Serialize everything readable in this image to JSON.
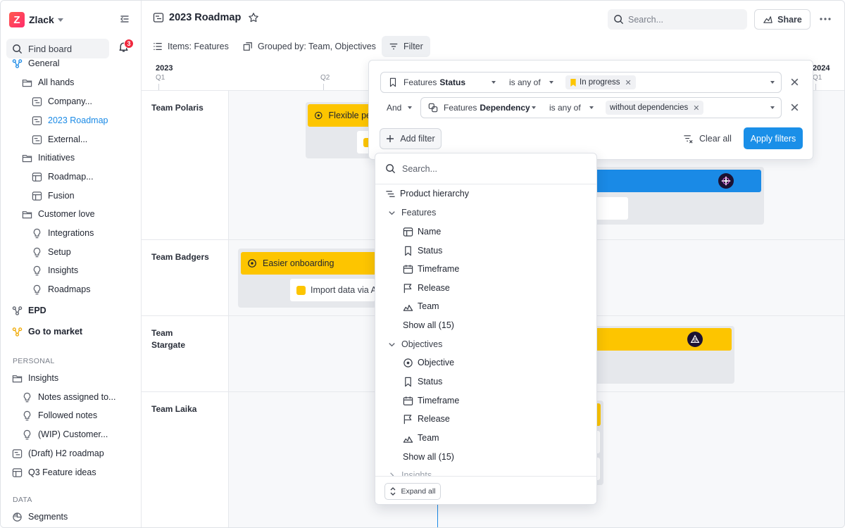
{
  "workspace": {
    "name": "Zlack",
    "logo_letter": "Z"
  },
  "sidebar": {
    "find_board": "Find board",
    "notification_count": "3",
    "items": [
      {
        "label": "General",
        "icon": "branch-icon"
      },
      {
        "label": "All hands",
        "icon": "folder-icon"
      },
      {
        "label": "Company...",
        "icon": "timeline-icon"
      },
      {
        "label": "2023 Roadmap",
        "icon": "timeline-icon",
        "active": true
      },
      {
        "label": "External...",
        "icon": "timeline-icon"
      },
      {
        "label": "Initiatives",
        "icon": "folder-icon"
      },
      {
        "label": "Roadmap...",
        "icon": "grid-icon"
      },
      {
        "label": "Fusion",
        "icon": "grid-icon"
      },
      {
        "label": "Customer love",
        "icon": "folder-icon"
      },
      {
        "label": "Integrations",
        "icon": "bulb-icon"
      },
      {
        "label": "Setup",
        "icon": "bulb-icon"
      },
      {
        "label": "Insights",
        "icon": "bulb-icon"
      },
      {
        "label": "Roadmaps",
        "icon": "bulb-icon"
      },
      {
        "label": "EPD",
        "icon": "branch-icon"
      },
      {
        "label": "Go to market",
        "icon": "branch-icon"
      },
      {
        "label": "Insights",
        "icon": "folder-icon"
      },
      {
        "label": "Notes assigned to...",
        "icon": "bulb-icon"
      },
      {
        "label": "Followed notes",
        "icon": "bulb-icon"
      },
      {
        "label": "(WIP) Customer...",
        "icon": "bulb-icon"
      },
      {
        "label": "(Draft) H2 roadmap",
        "icon": "timeline-icon"
      },
      {
        "label": "Q3 Feature ideas",
        "icon": "grid-icon"
      },
      {
        "label": "Segments",
        "icon": "pie-icon"
      }
    ],
    "sections": {
      "personal": "PERSONAL",
      "data": "DATA"
    }
  },
  "topbar": {
    "title": "2023 Roadmap",
    "search_placeholder": "Search...",
    "share_label": "Share"
  },
  "toolbar": {
    "items_label": "Items: Features",
    "grouped_label": "Grouped by: Team, Objectives",
    "filter_label": "Filter"
  },
  "timeline": {
    "year_start": "2023",
    "year_end": "2024",
    "q1": "Q1",
    "q2": "Q2",
    "q1_next": "Q1",
    "lanes": [
      "Team Polaris",
      "Team Badgers",
      "Team Stargate",
      "Team Laika"
    ],
    "bars": {
      "flexible": "Flexible pe",
      "easier_onboarding": "Easier onboarding",
      "import_data": "Import data via AP"
    }
  },
  "filter_panel": {
    "row1": {
      "field_prefix": "Features",
      "field": "Status",
      "operator": "is any of",
      "value": "In progress"
    },
    "row2": {
      "conjunction": "And",
      "field_prefix": "Features",
      "field": "Dependency",
      "operator": "is any of",
      "value": "without dependencies"
    },
    "add_filter": "Add filter",
    "clear_all": "Clear all",
    "apply": "Apply filters"
  },
  "dropdown": {
    "search_placeholder": "Search...",
    "product_hierarchy": "Product hierarchy",
    "features": {
      "label": "Features",
      "items": [
        "Name",
        "Status",
        "Timeframe",
        "Release",
        "Team"
      ],
      "show_all": "Show all (15)"
    },
    "objectives": {
      "label": "Objectives",
      "items": [
        "Objective",
        "Status",
        "Timeframe",
        "Release",
        "Team"
      ],
      "show_all": "Show all (15)"
    },
    "insights": "Insights",
    "expand_all": "Expand all"
  },
  "colors": {
    "accent_blue": "#1a8fe8",
    "objective_yellow": "#fdc500",
    "notification_red": "#f0293e",
    "logo_red": "#ff3b5c"
  }
}
